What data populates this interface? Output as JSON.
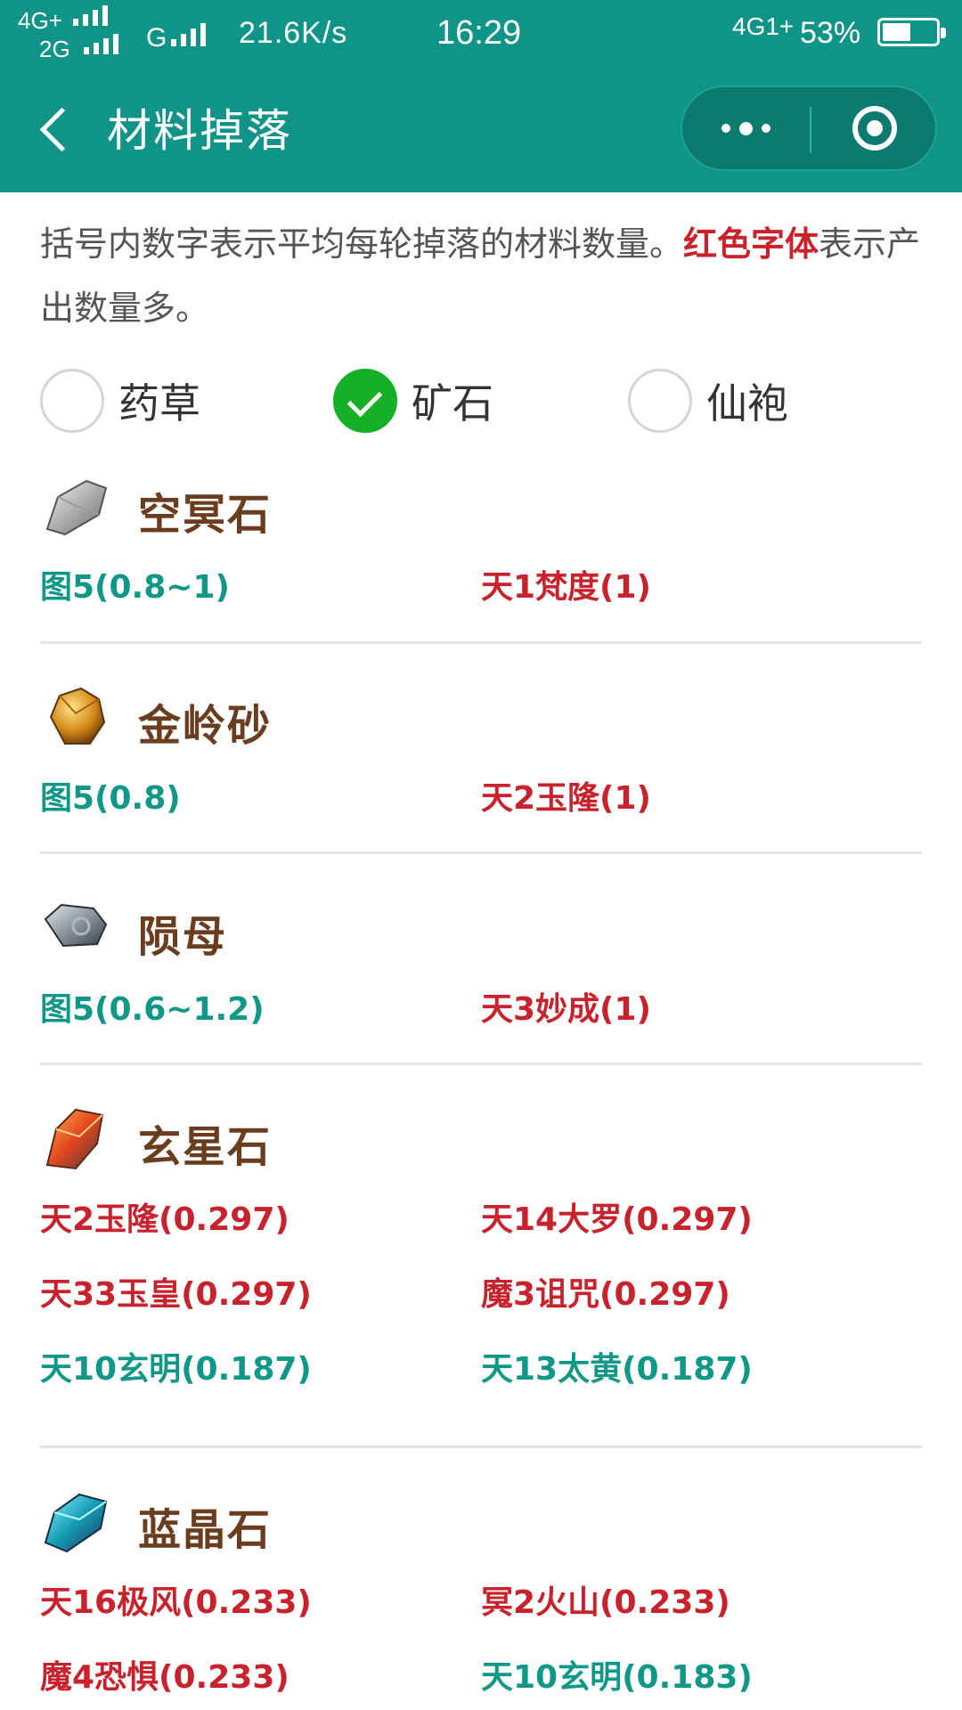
{
  "status_bar": {
    "network_top": "4G+",
    "network_bottom": "2G",
    "carrier_g": "G",
    "speed": "21.6K/s",
    "time": "16:29",
    "network_right": "4G1+",
    "battery": "53%",
    "battery_level": 0.53
  },
  "navbar": {
    "title": "材料掉落",
    "back_icon": "back-arrow-icon",
    "more_icon": "more-dots-icon",
    "close_icon": "target-circle-icon"
  },
  "intro": {
    "part1": "括号内数字表示平均每轮掉落的材料数量。",
    "highlight": "红色字体",
    "part2": "表示产出数量多。"
  },
  "tabs": [
    {
      "label": "药草",
      "checked": false
    },
    {
      "label": "矿石",
      "checked": true
    },
    {
      "label": "仙袍",
      "checked": false
    }
  ],
  "colors": {
    "header": "#109488",
    "red": "#c8232c",
    "teal": "#0f9787",
    "check": "#15b025",
    "material_name": "#6b3d1f"
  },
  "materials": [
    {
      "name": "空冥石",
      "icon": "gray-ore-icon",
      "drops": [
        {
          "text": "图5(0.8~1)",
          "color": "teal"
        },
        {
          "text": "天1梵度(1)",
          "color": "red"
        }
      ]
    },
    {
      "name": "金岭砂",
      "icon": "gold-ore-icon",
      "drops": [
        {
          "text": "图5(0.8)",
          "color": "teal"
        },
        {
          "text": "天2玉隆(1)",
          "color": "red"
        }
      ]
    },
    {
      "name": "陨母",
      "icon": "meteor-ore-icon",
      "drops": [
        {
          "text": "图5(0.6~1.2)",
          "color": "teal"
        },
        {
          "text": "天3妙成(1)",
          "color": "red"
        }
      ]
    },
    {
      "name": "玄星石",
      "icon": "red-crystal-icon",
      "drops": [
        {
          "text": "天2玉隆(0.297)",
          "color": "red"
        },
        {
          "text": "天14大罗(0.297)",
          "color": "red"
        },
        {
          "text": "天33玉皇(0.297)",
          "color": "red"
        },
        {
          "text": "魔3诅咒(0.297)",
          "color": "red"
        },
        {
          "text": "天10玄明(0.187)",
          "color": "teal"
        },
        {
          "text": "天13太黄(0.187)",
          "color": "teal"
        }
      ]
    },
    {
      "name": "蓝晶石",
      "icon": "blue-crystal-icon",
      "drops": [
        {
          "text": "天16极风(0.233)",
          "color": "red"
        },
        {
          "text": "冥2火山(0.233)",
          "color": "red"
        },
        {
          "text": "魔4恐惧(0.233)",
          "color": "red"
        },
        {
          "text": "天10玄明(0.183)",
          "color": "teal"
        }
      ]
    }
  ]
}
